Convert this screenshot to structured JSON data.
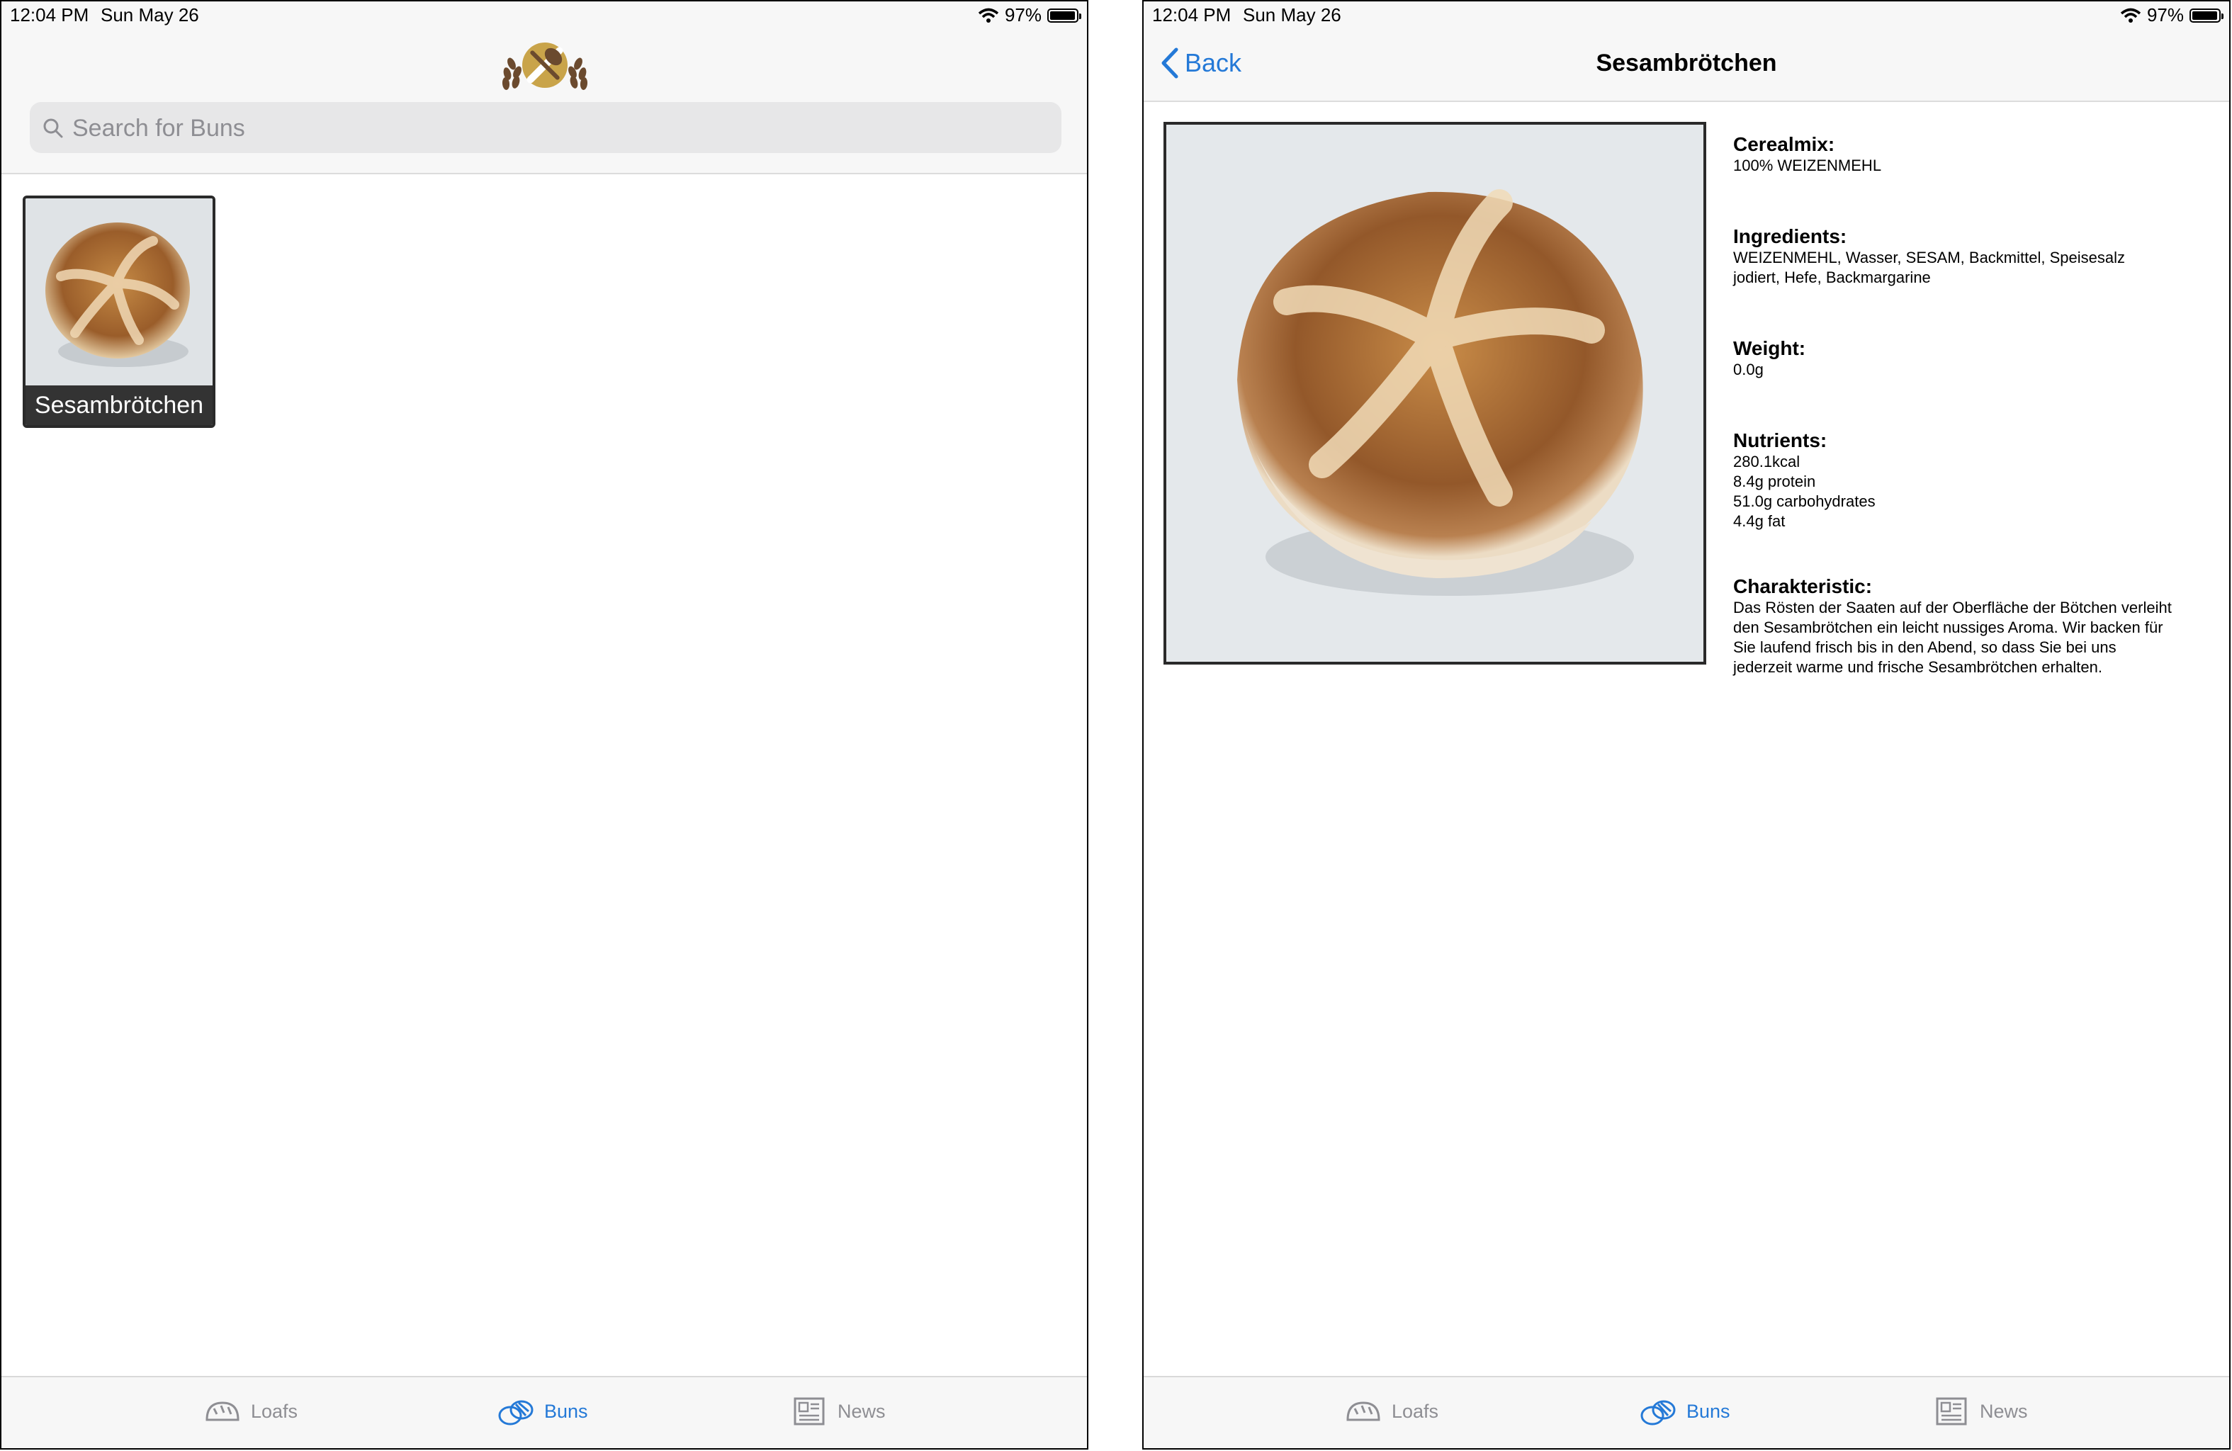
{
  "status_bar": {
    "time": "12:04 PM",
    "date": "Sun May 26",
    "battery": "97%",
    "battery_level": 0.97
  },
  "list_screen": {
    "search": {
      "placeholder": "Search for Buns",
      "value": ""
    },
    "items": [
      {
        "name": "Sesambrötchen"
      }
    ]
  },
  "detail_screen": {
    "back_label": "Back",
    "title": "Sesambrötchen",
    "sections": [
      {
        "label": "Cerealmix:",
        "lines": [
          "100% WEIZENMEHL"
        ]
      },
      {
        "label": "Ingredients:",
        "lines": [
          "WEIZENMEHL, Wasser, SESAM, Backmittel, Speisesalz",
          "jodiert, Hefe, Backmargarine"
        ]
      },
      {
        "label": "Weight:",
        "lines": [
          "0.0g"
        ]
      },
      {
        "label": "Nutrients:",
        "lines": [
          "280.1kcal",
          "8.4g protein",
          "51.0g carbohydrates",
          "4.4g fat"
        ]
      },
      {
        "label": "Charakteristic:",
        "lines": [
          "Das Rösten der Saaten auf der Oberfläche der Bötchen verleiht",
          "den Sesambrötchen ein leicht nussiges Aroma. Wir backen für",
          "Sie laufend frisch bis in den Abend, so dass Sie bei uns",
          "jederzeit warme und frische Sesambrötchen erhalten."
        ]
      }
    ]
  },
  "tab_bar": {
    "tabs": [
      {
        "label": "Loafs",
        "icon": "loaf-icon",
        "active": false
      },
      {
        "label": "Buns",
        "icon": "buns-icon",
        "active": true
      },
      {
        "label": "News",
        "icon": "news-icon",
        "active": false
      }
    ]
  },
  "colors": {
    "accent": "#2479d7",
    "inactive": "#8e8e93",
    "logo_gold": "#c9a44a",
    "logo_brown": "#6b4a2e"
  }
}
